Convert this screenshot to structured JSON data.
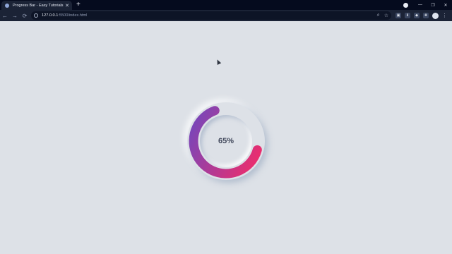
{
  "browser": {
    "tab": {
      "title": "Progress Bar - Easy Tutorials You...",
      "close_label": "✕"
    },
    "new_tab_label": "+",
    "window_controls": [
      "—",
      "❐",
      "✕"
    ],
    "nav": {
      "back": "←",
      "forward": "→",
      "reload": "⟳"
    },
    "address": {
      "host": "127.0.0.1",
      "rest": ":5500/index.html"
    },
    "address_icons": [
      "search-icon",
      "star-icon"
    ],
    "extensions": [
      "extension-1-icon",
      "extension-2-icon",
      "extension-3-icon",
      "puzzle-icon"
    ],
    "menu_label": "⋮"
  },
  "page": {
    "progress": {
      "value_text": "65%",
      "value": 0.65
    },
    "colors": {
      "background": "#dde1e7",
      "gradient_start": "#f72b66",
      "gradient_end": "#6e48c0"
    }
  }
}
